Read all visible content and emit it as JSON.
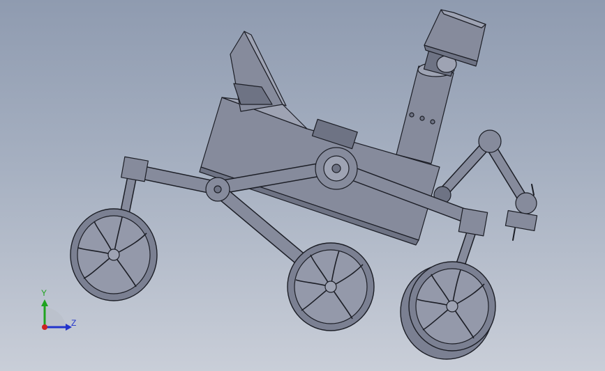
{
  "view": {
    "background_top": "#8f9bb0",
    "background_bottom": "#c9ced8",
    "model_color": "#868b9c",
    "edge_color": "#1c1e26"
  },
  "triad": {
    "y_label": "Y",
    "z_label": "Z",
    "y_color": "#1fa31f",
    "z_color": "#2233cc",
    "x_color": "#cc2222"
  }
}
